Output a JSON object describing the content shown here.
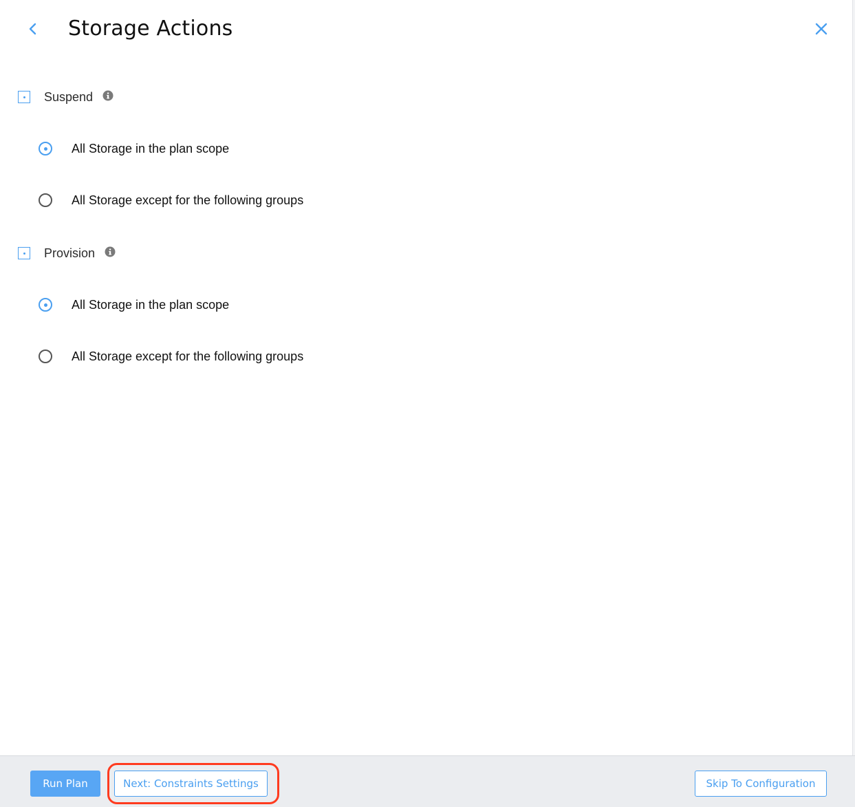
{
  "header": {
    "title": "Storage Actions",
    "back_icon": "chevron-left-icon",
    "close_icon": "close-icon"
  },
  "sections": [
    {
      "label": "Suspend",
      "options": [
        {
          "label": "All Storage in the plan scope",
          "selected": true
        },
        {
          "label": "All Storage except for the following groups",
          "selected": false
        }
      ]
    },
    {
      "label": "Provision",
      "options": [
        {
          "label": "All Storage in the plan scope",
          "selected": true
        },
        {
          "label": "All Storage except for the following groups",
          "selected": false
        }
      ]
    }
  ],
  "footer": {
    "run_plan_label": "Run Plan",
    "next_label": "Next: Constraints Settings",
    "skip_label": "Skip To Configuration"
  },
  "colors": {
    "accent": "#4a9ff0",
    "primary_button": "#58a6f4",
    "footer_background": "#ebedf0",
    "highlight": "#ff3b1f"
  }
}
